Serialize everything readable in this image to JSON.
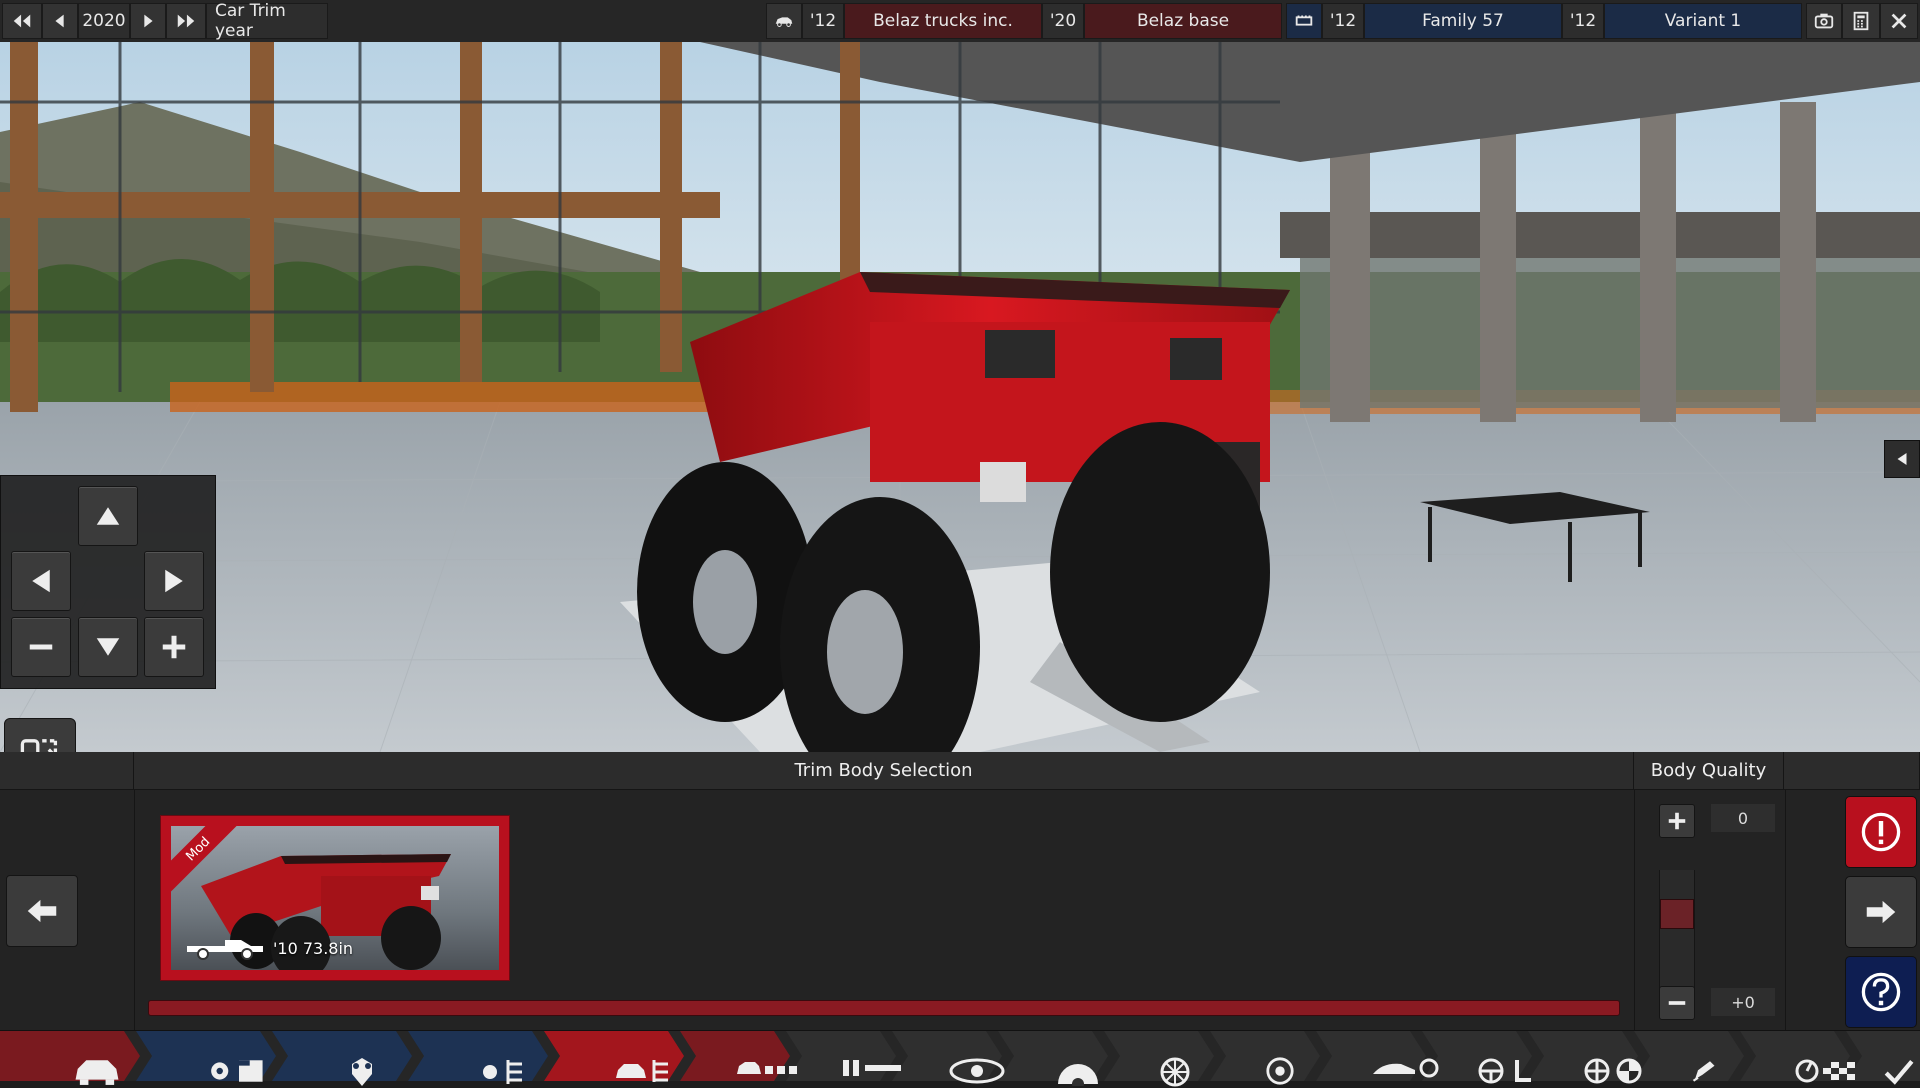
{
  "topbar": {
    "year": "2020",
    "trim_year_label": "Car Trim year",
    "model_year": "'12",
    "brand": "Belaz trucks inc.",
    "brand_year": "'20",
    "model": "Belaz base",
    "family_year": "'12",
    "family": "Family 57",
    "variant_year": "'12",
    "variant": "Variant 1"
  },
  "panel": {
    "section_title": "Trim Body Selection",
    "quality_title": "Body Quality",
    "quality_value": "0",
    "quality_delta": "+0",
    "body_card": {
      "badge": "Mod",
      "caption": "'10 73.8in"
    }
  },
  "colors": {
    "accent_red": "#b8101e",
    "accent_blue": "#1b2b46",
    "panel": "#232323"
  },
  "icons": {
    "rewind": "double-left-arrow-icon",
    "prev": "left-arrow-icon",
    "next": "right-arrow-icon",
    "forward": "double-right-arrow-icon",
    "camera": "camera-icon",
    "calculator": "calculator-icon",
    "close": "close-icon"
  }
}
